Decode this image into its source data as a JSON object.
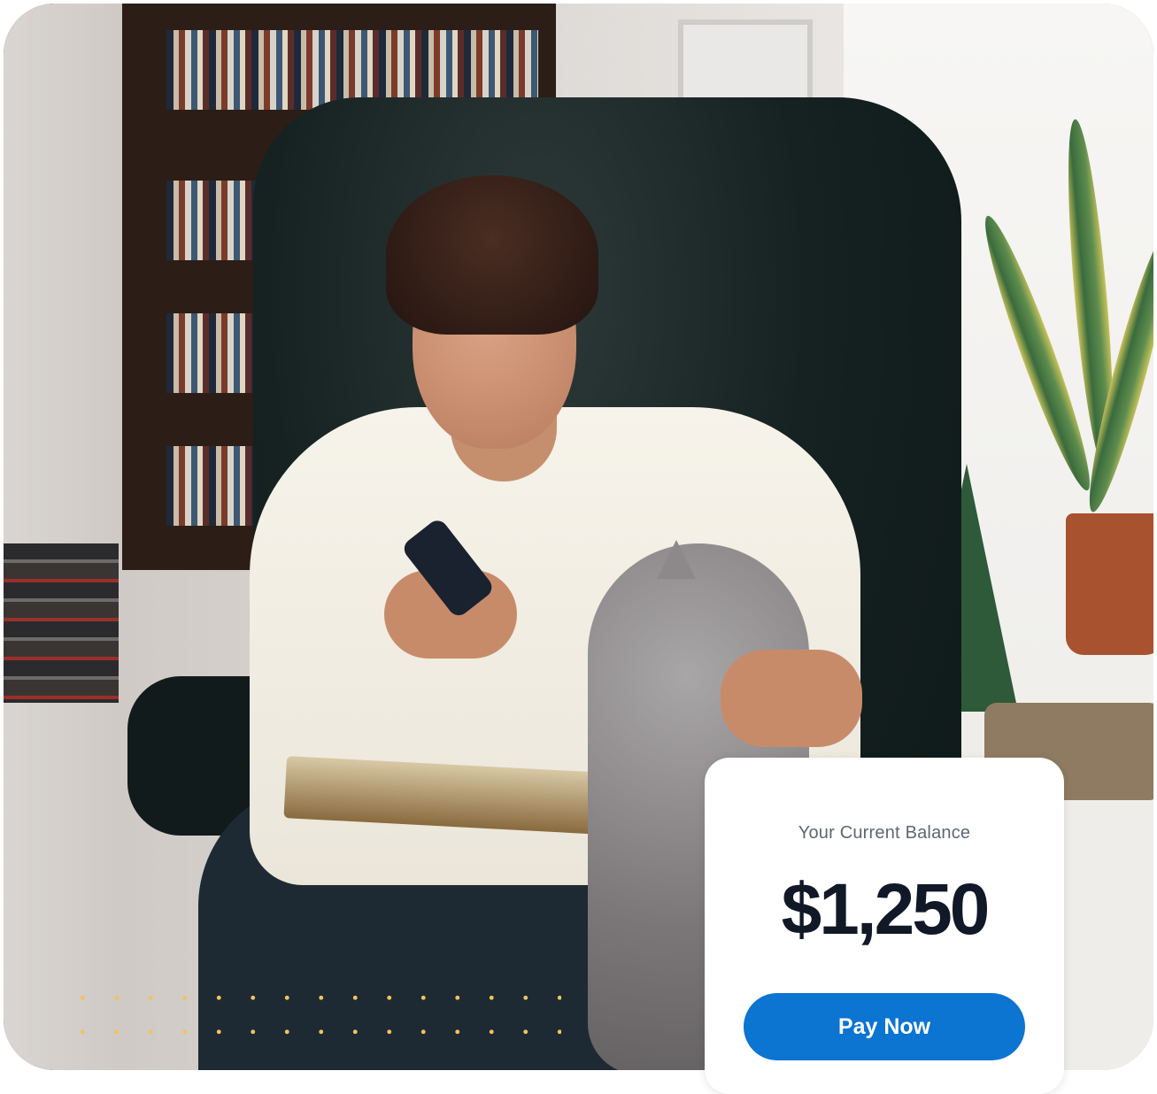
{
  "balance_card": {
    "label": "Your Current Balance",
    "amount": "$1,250",
    "pay_button_label": "Pay Now"
  },
  "colors": {
    "primary_button": "#0c74d1",
    "amount_text": "#111827",
    "label_text": "#5f6673",
    "dots_accent": "#f2c35a"
  }
}
